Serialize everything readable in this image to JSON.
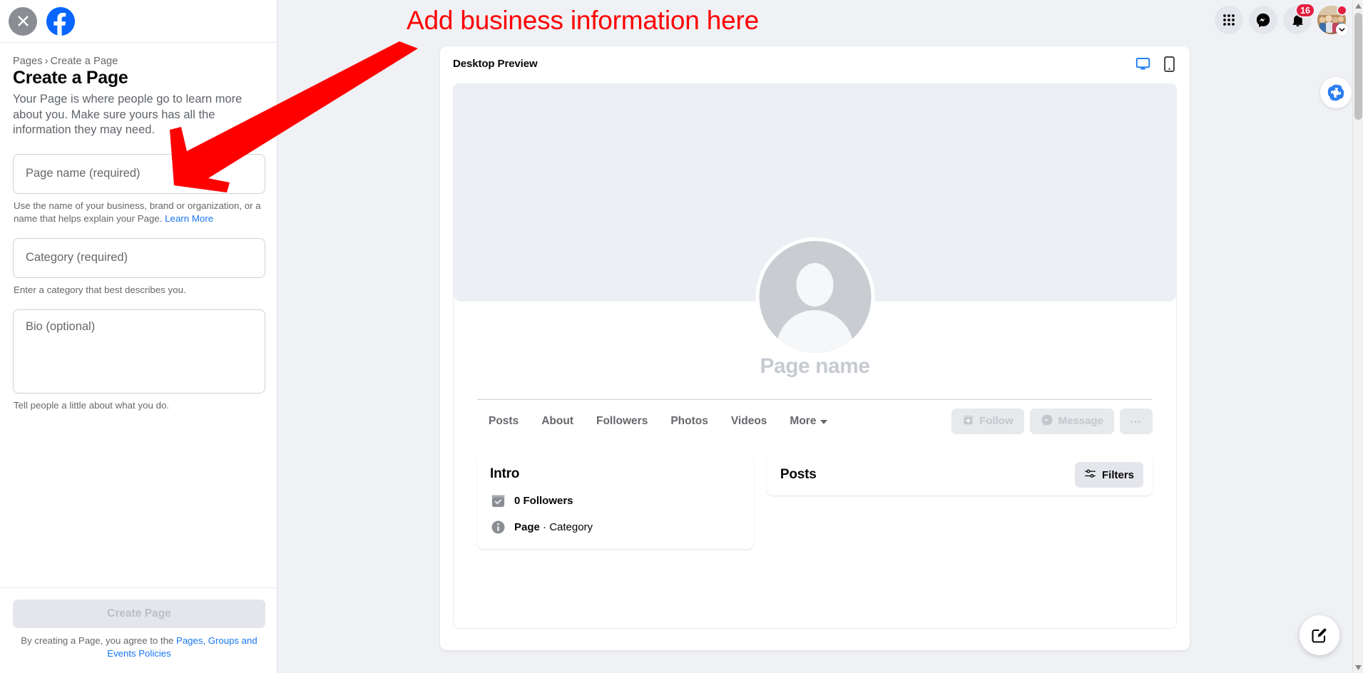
{
  "colors": {
    "accent_blue": "#1877f2",
    "fb_blue": "#0866ff",
    "annotation_red": "#ff0000",
    "badge_red": "#e41e3f",
    "page_bg": "#eff1f5"
  },
  "annotation": {
    "text": "Add business information here",
    "arrow": "down-left-arrow"
  },
  "sidebar": {
    "close_icon": "close-icon",
    "logo_icon": "facebook-logo-icon",
    "breadcrumb": {
      "parent": "Pages",
      "separator": "›",
      "current": "Create a Page"
    },
    "title": "Create a Page",
    "description": "Your Page is where people go to learn more about you. Make sure yours has all the information they may need.",
    "fields": [
      {
        "name": "page-name",
        "label": "Page name (required)",
        "value": "",
        "helper": "Use the name of your business, brand or organization, or a name that helps explain your Page.",
        "helper_link": "Learn More",
        "type": "input"
      },
      {
        "name": "category",
        "label": "Category (required)",
        "value": "",
        "helper": "Enter a category that best describes you.",
        "helper_link": "",
        "type": "input"
      },
      {
        "name": "bio",
        "label": "Bio (optional)",
        "value": "",
        "helper": "Tell people a little about what you do.",
        "helper_link": "",
        "type": "textarea"
      }
    ],
    "submit_label": "Create Page",
    "terms_prefix": "By creating a Page, you agree to the ",
    "terms_link": "Pages, Groups and Events Policies"
  },
  "header": {
    "apps_icon": "grid-apps-icon",
    "messenger_icon": "messenger-icon",
    "notifications_icon": "bell-icon",
    "notifications_count": "16",
    "avatar_icon": "avatar",
    "avatar_chevron_icon": "chevron-down-icon"
  },
  "preview": {
    "title": "Desktop Preview",
    "device_desktop_icon": "desktop-monitor-icon",
    "device_mobile_icon": "mobile-phone-icon",
    "active_device": "desktop",
    "page_name_placeholder": "Page name",
    "profile_icon": "default-avatar-icon",
    "tabs": [
      {
        "label": "Posts",
        "has_caret": false
      },
      {
        "label": "About",
        "has_caret": false
      },
      {
        "label": "Followers",
        "has_caret": false
      },
      {
        "label": "Photos",
        "has_caret": false
      },
      {
        "label": "Videos",
        "has_caret": false
      },
      {
        "label": "More",
        "has_caret": true
      }
    ],
    "actions": [
      {
        "label": "Follow",
        "icon": "follow-plus-icon"
      },
      {
        "label": "Message",
        "icon": "messenger-icon"
      },
      {
        "label": "…",
        "icon": "more-dots-icon"
      }
    ],
    "intro": {
      "title": "Intro",
      "rows": [
        {
          "icon": "followers-check-icon",
          "strong": "0",
          "rest": " Followers"
        },
        {
          "icon": "info-circle-icon",
          "strong": "Page",
          "rest": " · Category"
        }
      ]
    },
    "posts": {
      "title": "Posts",
      "filters_label": "Filters",
      "filters_icon": "sliders-filter-icon"
    }
  },
  "overlays": {
    "extension_icon": "blue-spiral-extension-icon",
    "compose_fab_icon": "compose-pencil-icon",
    "scrollbar_up_icon": "scroll-up-arrow-icon",
    "scrollbar_down_icon": "scroll-down-arrow-icon"
  }
}
